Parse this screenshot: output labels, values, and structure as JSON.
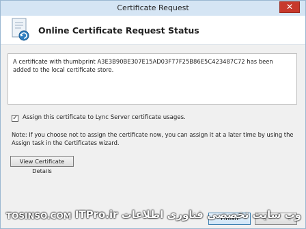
{
  "window": {
    "title": "Certificate Request",
    "close_icon": "close-icon"
  },
  "header": {
    "title": "Online Certificate Request Status",
    "icon": "certificate-icon"
  },
  "message": "A certificate with thumbprint A3E3B90BE307E15AD03F77F25B86E5C423487C72 has been added to the local certificate store.",
  "assign_checkbox": {
    "checked": true,
    "label": "Assign this certificate to Lync Server certificate usages."
  },
  "note": "Note: If you choose not to assign the certificate now, you can assign it at a later time by using the Assign task in the Certificates wizard.",
  "buttons": {
    "view_details": "View Certificate Details",
    "finish": "Finish"
  },
  "watermark": {
    "left": "TOSINSO.COM",
    "right": "وب سایت تخصصی فناوری اطلاعات ITPro.ir"
  },
  "colors": {
    "close_button": "#c7392c",
    "finish_border": "#3c7fb1"
  }
}
